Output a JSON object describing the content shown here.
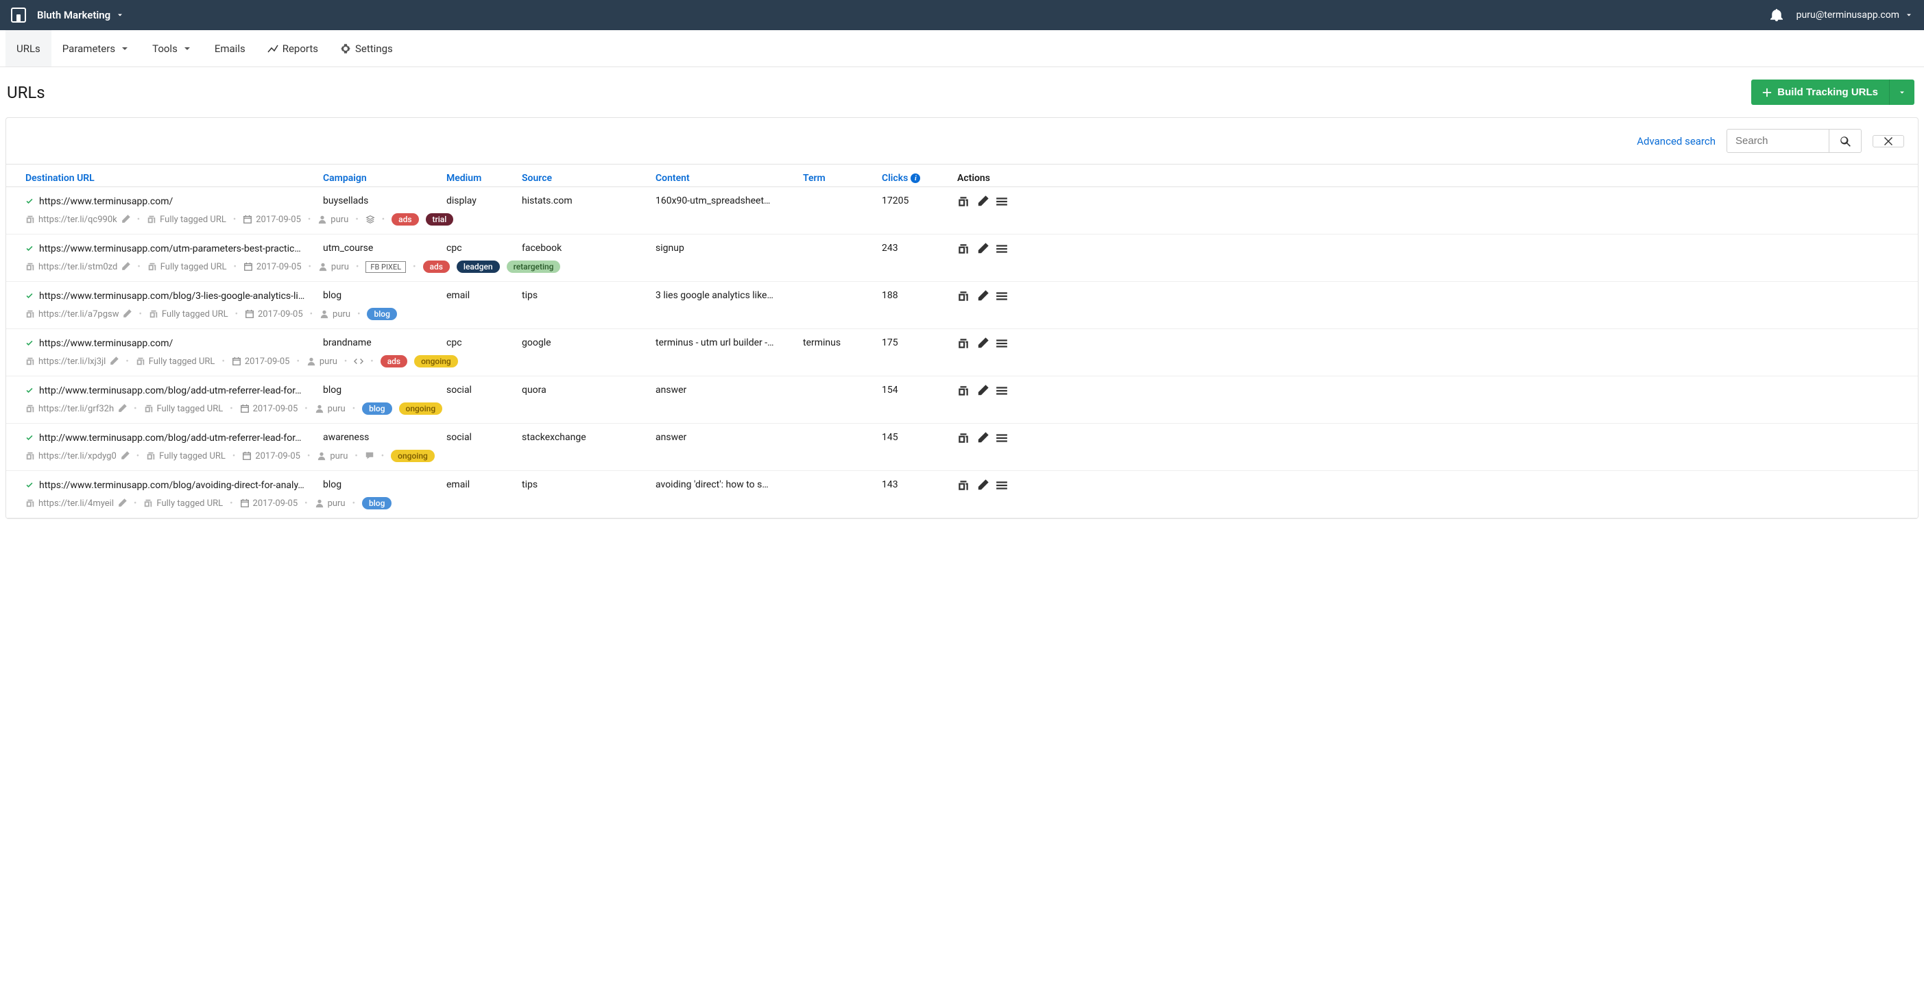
{
  "topbar": {
    "workspace": "Bluth Marketing",
    "user_email": "puru@terminusapp.com"
  },
  "nav": {
    "urls": "URLs",
    "parameters": "Parameters",
    "tools": "Tools",
    "emails": "Emails",
    "reports": "Reports",
    "settings": "Settings"
  },
  "page": {
    "title": "URLs",
    "build_btn": "Build Tracking URLs",
    "advanced_search": "Advanced search",
    "search_placeholder": "Search"
  },
  "columns": {
    "destination": "Destination URL",
    "campaign": "Campaign",
    "medium": "Medium",
    "source": "Source",
    "content": "Content",
    "term": "Term",
    "clicks": "Clicks",
    "actions": "Actions"
  },
  "rows": [
    {
      "url": "https://www.terminusapp.com/",
      "campaign": "buysellads",
      "medium": "display",
      "source": "histats.com",
      "content": "160x90-utm_spreadsheet…",
      "term": "",
      "clicks": "17205",
      "short": "https://ter.li/qc990k",
      "tagged": "Fully tagged URL",
      "date": "2017-09-05",
      "user": "puru",
      "extra_box": "",
      "extra_icon": "layers",
      "tags": [
        {
          "label": "ads",
          "cls": "pill-red"
        },
        {
          "label": "trial",
          "cls": "pill-dark"
        }
      ]
    },
    {
      "url": "https://www.terminusapp.com/utm-parameters-best-practic…",
      "campaign": "utm_course",
      "medium": "cpc",
      "source": "facebook",
      "content": "signup",
      "term": "",
      "clicks": "243",
      "short": "https://ter.li/stm0zd",
      "tagged": "Fully tagged URL",
      "date": "2017-09-05",
      "user": "puru",
      "extra_box": "FB PIXEL",
      "extra_icon": "",
      "tags": [
        {
          "label": "ads",
          "cls": "pill-red"
        },
        {
          "label": "leadgen",
          "cls": "pill-navy"
        },
        {
          "label": "retargeting",
          "cls": "pill-green-light"
        }
      ]
    },
    {
      "url": "https://www.terminusapp.com/blog/3-lies-google-analytics-li…",
      "campaign": "blog",
      "medium": "email",
      "source": "tips",
      "content": "3 lies google analytics like…",
      "term": "",
      "clicks": "188",
      "short": "https://ter.li/a7pgsw",
      "tagged": "Fully tagged URL",
      "date": "2017-09-05",
      "user": "puru",
      "extra_box": "",
      "extra_icon": "",
      "tags": [
        {
          "label": "blog",
          "cls": "pill-blue"
        }
      ]
    },
    {
      "url": "https://www.terminusapp.com/",
      "campaign": "brandname",
      "medium": "cpc",
      "source": "google",
      "content": "terminus - utm url builder -…",
      "term": "terminus",
      "clicks": "175",
      "short": "https://ter.li/lxj3jl",
      "tagged": "Fully tagged URL",
      "date": "2017-09-05",
      "user": "puru",
      "extra_box": "",
      "extra_icon": "code",
      "tags": [
        {
          "label": "ads",
          "cls": "pill-red"
        },
        {
          "label": "ongoing",
          "cls": "pill-yellow"
        }
      ]
    },
    {
      "url": "http://www.terminusapp.com/blog/add-utm-referrer-lead-for…",
      "campaign": "blog",
      "medium": "social",
      "source": "quora",
      "content": "answer",
      "term": "",
      "clicks": "154",
      "short": "https://ter.li/grf32h",
      "tagged": "Fully tagged URL",
      "date": "2017-09-05",
      "user": "puru",
      "extra_box": "",
      "extra_icon": "",
      "tags": [
        {
          "label": "blog",
          "cls": "pill-blue"
        },
        {
          "label": "ongoing",
          "cls": "pill-yellow"
        }
      ]
    },
    {
      "url": "http://www.terminusapp.com/blog/add-utm-referrer-lead-for…",
      "campaign": "awareness",
      "medium": "social",
      "source": "stackexchange",
      "content": "answer",
      "term": "",
      "clicks": "145",
      "short": "https://ter.li/xpdyg0",
      "tagged": "Fully tagged URL",
      "date": "2017-09-05",
      "user": "puru",
      "extra_box": "",
      "extra_icon": "comment",
      "tags": [
        {
          "label": "ongoing",
          "cls": "pill-yellow"
        }
      ]
    },
    {
      "url": "https://www.terminusapp.com/blog/avoiding-direct-for-analy…",
      "campaign": "blog",
      "medium": "email",
      "source": "tips",
      "content": "avoiding 'direct': how to s…",
      "term": "",
      "clicks": "143",
      "short": "https://ter.li/4myeil",
      "tagged": "Fully tagged URL",
      "date": "2017-09-05",
      "user": "puru",
      "extra_box": "",
      "extra_icon": "",
      "tags": [
        {
          "label": "blog",
          "cls": "pill-blue"
        }
      ]
    }
  ]
}
